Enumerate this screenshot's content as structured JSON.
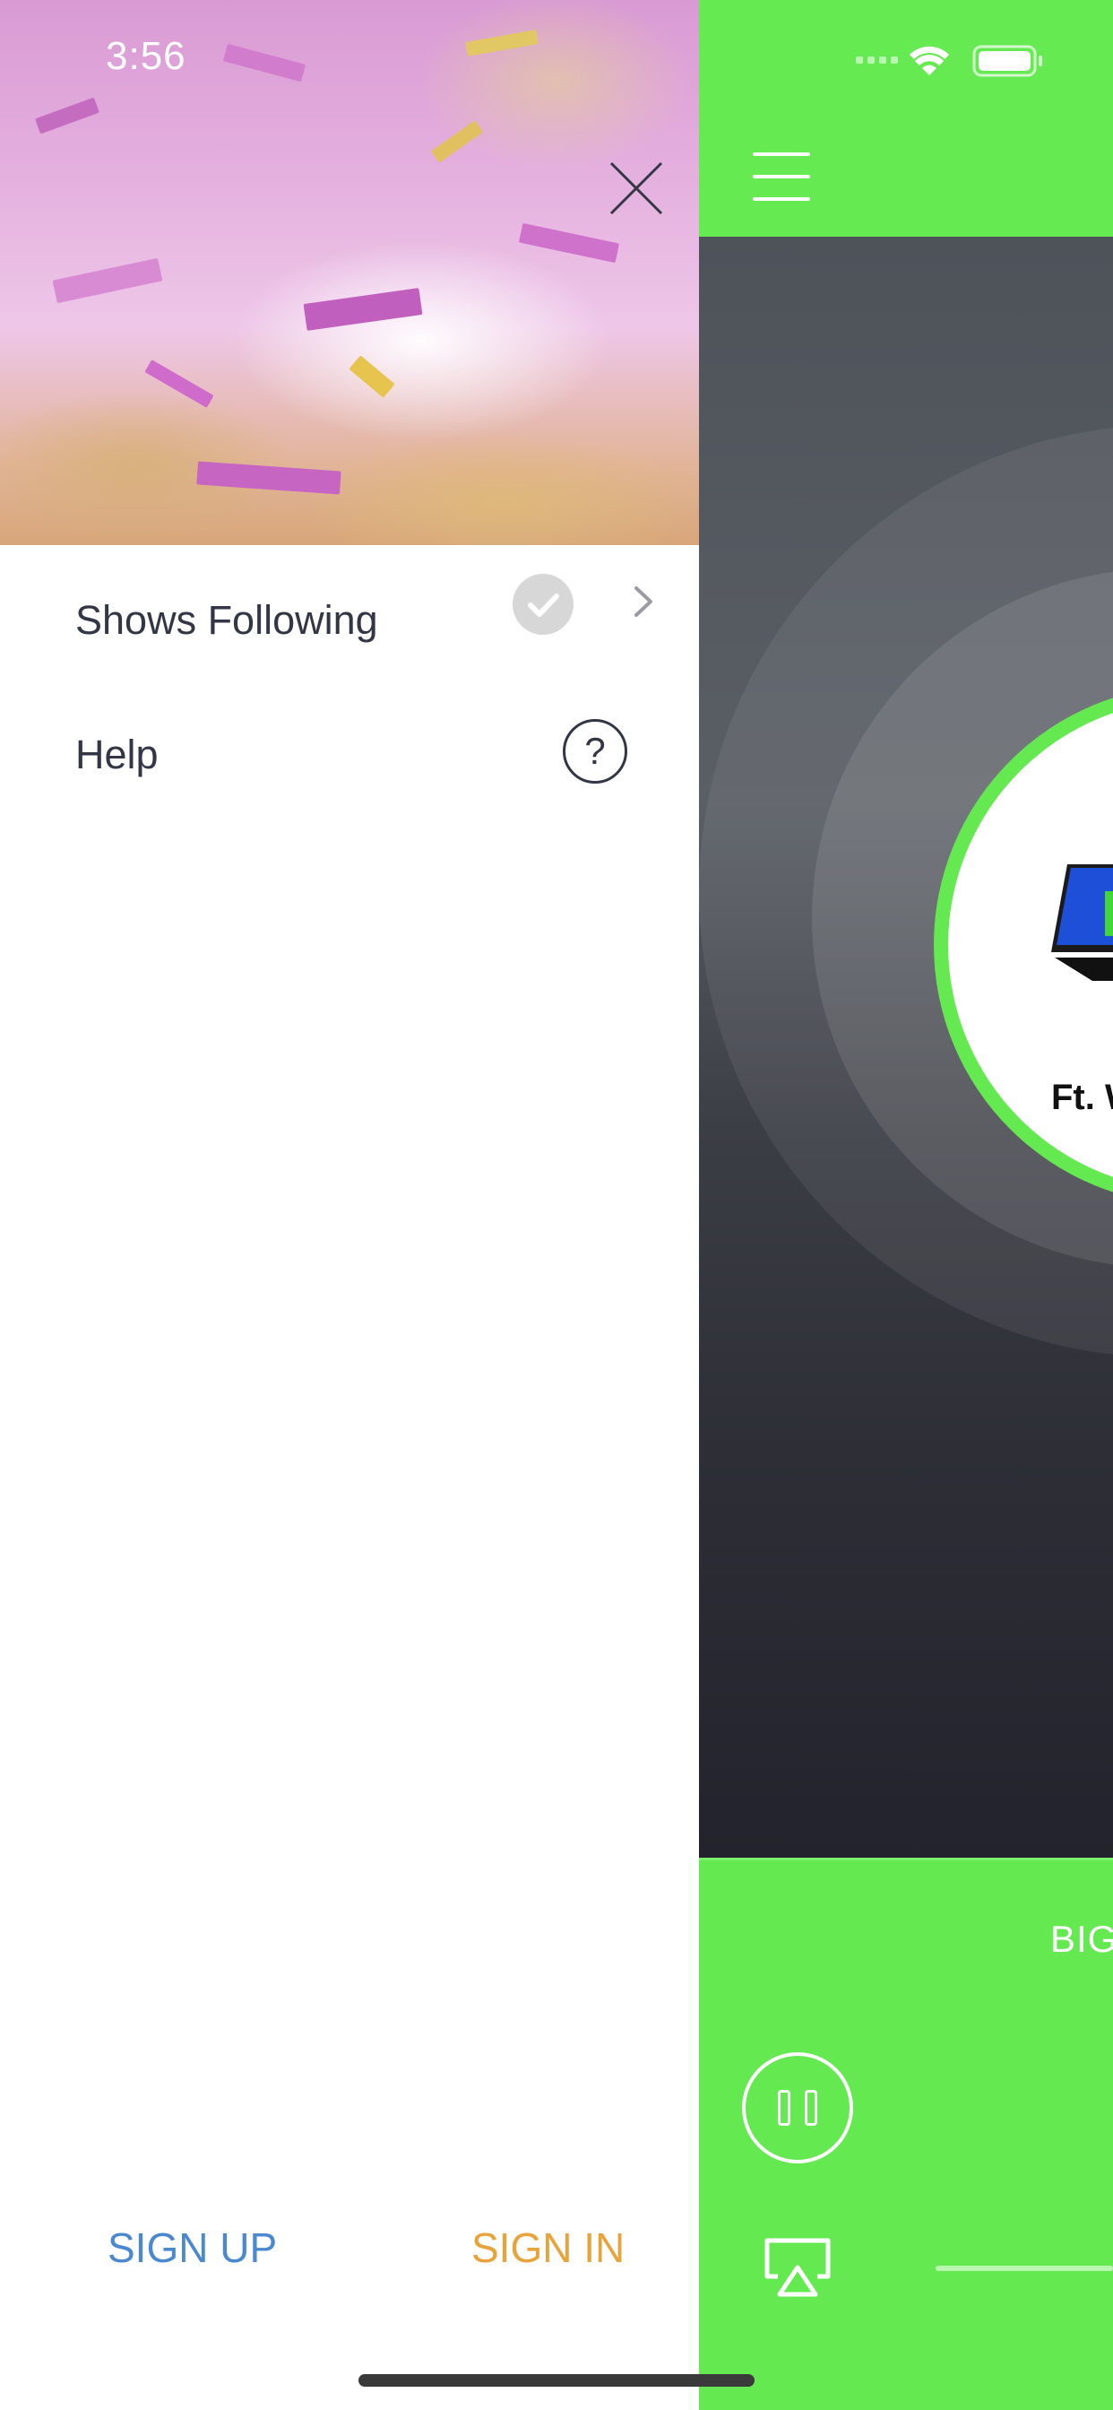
{
  "status_bar": {
    "time": "3:56"
  },
  "drawer": {
    "menu": [
      {
        "label": "Shows Following",
        "icon": "checkmark-icon"
      },
      {
        "label": "Help",
        "icon": "question-icon",
        "icon_glyph": "?"
      }
    ],
    "sign_up": "SIGN UP",
    "sign_in": "SIGN IN"
  },
  "player": {
    "logo_text": "Ft. W",
    "now_playing": "BIG"
  },
  "colors": {
    "accent_green": "#63ea51",
    "sign_up": "#4a88d0",
    "sign_in": "#e8a33a",
    "text": "#333645"
  }
}
